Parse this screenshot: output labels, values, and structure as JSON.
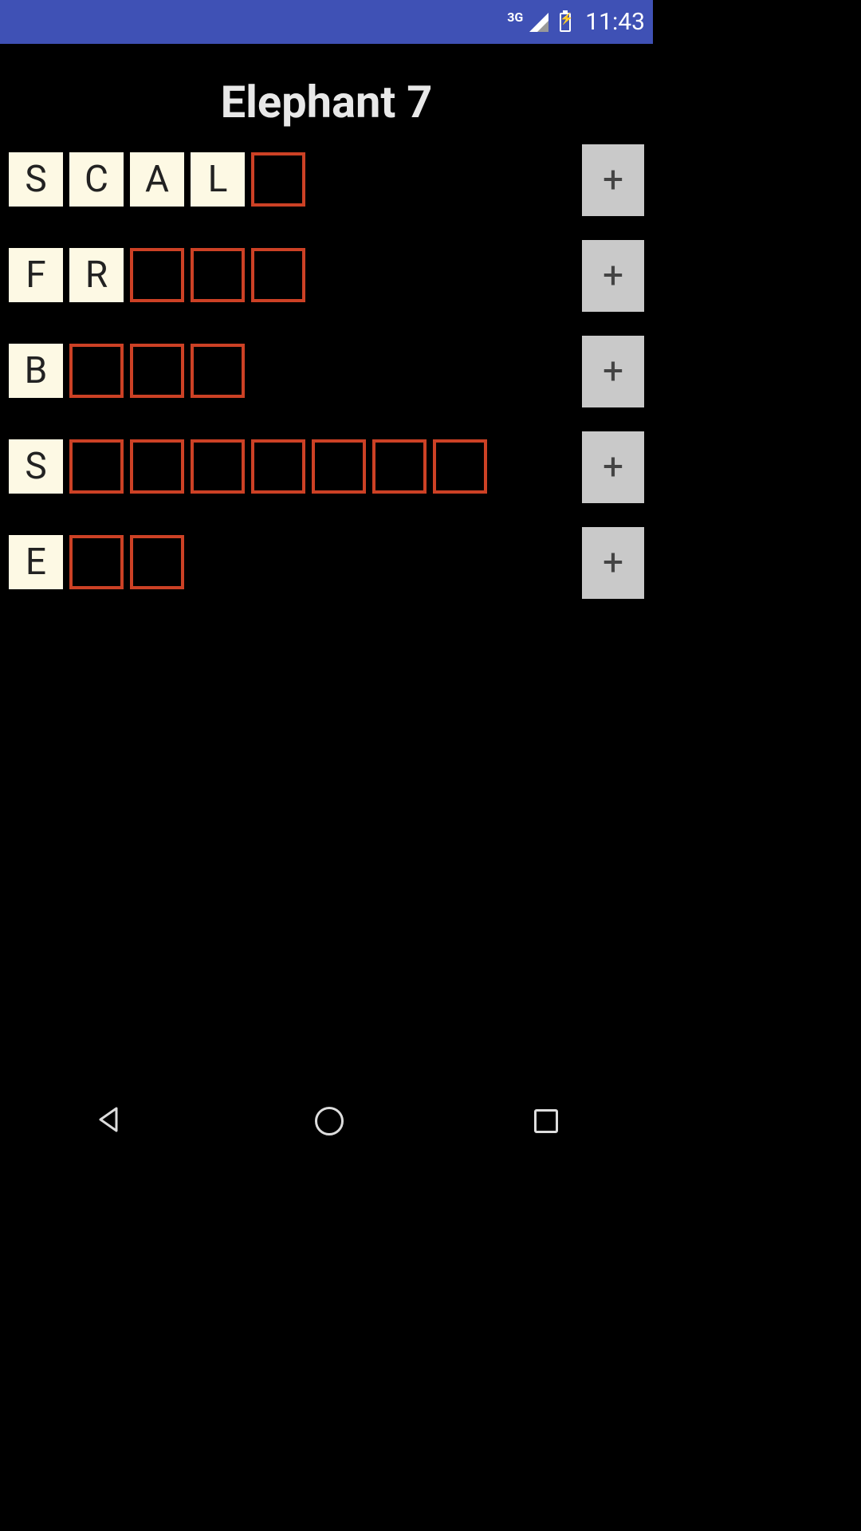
{
  "status": {
    "network": "3G",
    "time": "11:43"
  },
  "title": "Elephant 7",
  "rows": [
    {
      "filled": [
        "S",
        "C",
        "A",
        "L"
      ],
      "empty_count": 1,
      "hint_label": "+"
    },
    {
      "filled": [
        "F",
        "R"
      ],
      "empty_count": 3,
      "hint_label": "+"
    },
    {
      "filled": [
        "B"
      ],
      "empty_count": 3,
      "hint_label": "+"
    },
    {
      "filled": [
        "S"
      ],
      "empty_count": 7,
      "hint_label": "+"
    },
    {
      "filled": [
        "E"
      ],
      "empty_count": 2,
      "hint_label": "+"
    }
  ]
}
